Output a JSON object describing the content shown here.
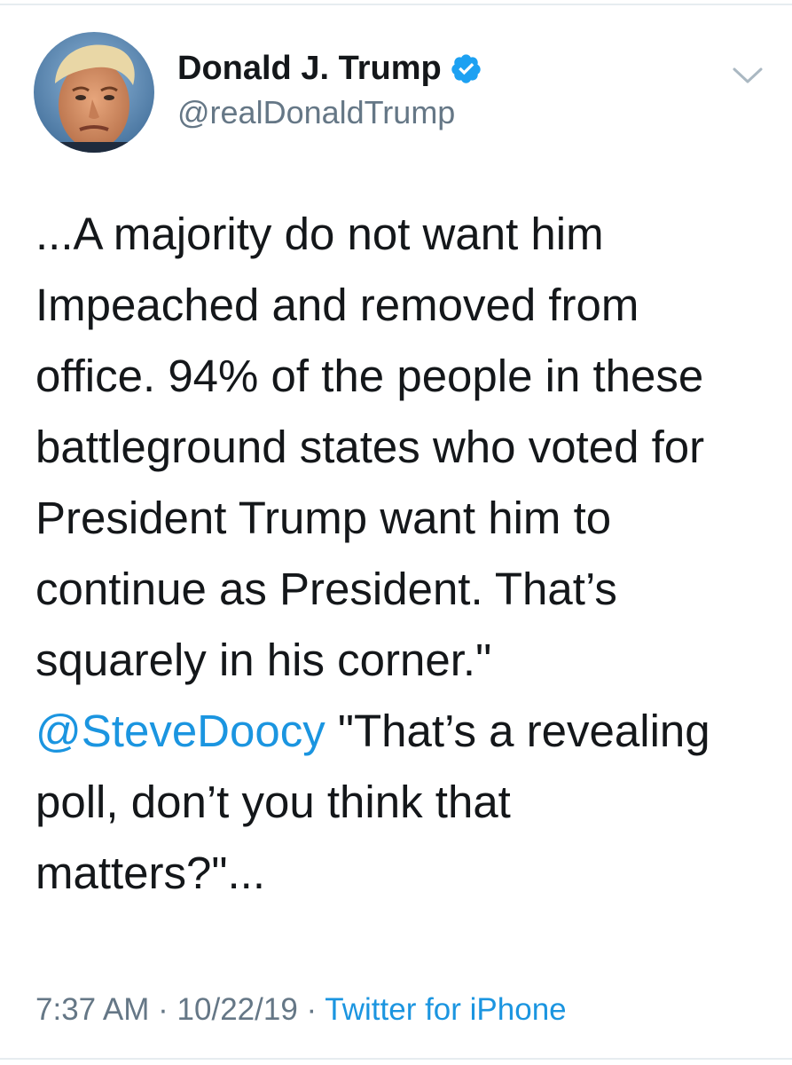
{
  "tweet": {
    "author": {
      "display_name": "Donald J. Trump",
      "handle": "@realDonaldTrump",
      "verified": true,
      "verified_icon": "verified-badge-icon",
      "avatar": "avatar"
    },
    "text_lines": [
      "...A majority do not want him",
      "Impeached and removed from",
      "office. 94% of the people in these",
      "battleground states who voted for",
      "President Trump want him to",
      "continue as President. That’s",
      "squarely in his corner.\"",
      {
        "mention": "@SteveDoocy",
        "rest": " \"That’s a revealing"
      },
      "poll, don’t you think that",
      "matters?\"..."
    ],
    "time": "7:37 AM",
    "date": "10/22/19",
    "separator": "·",
    "source": "Twitter for iPhone"
  },
  "icons": {
    "caret": "chevron-down-icon"
  },
  "colors": {
    "link": "#1b95e0",
    "secondary_text": "#657786",
    "primary_text": "#14171a",
    "verified": "#1da1f2",
    "divider": "#e6ecf0"
  }
}
